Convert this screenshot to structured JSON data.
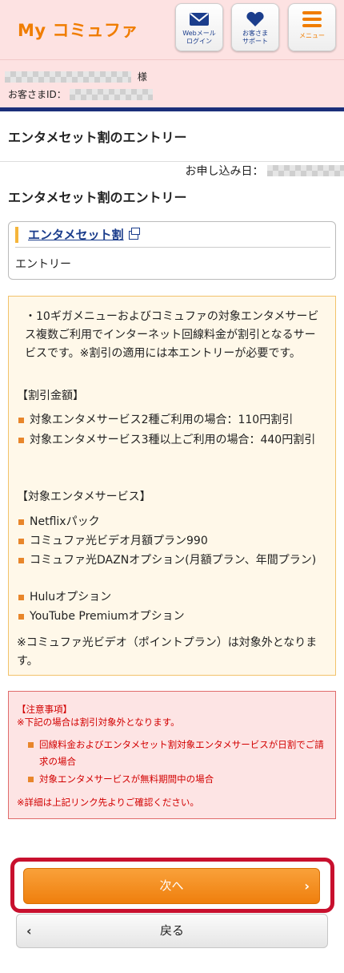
{
  "header": {
    "logo": "My コミュファ",
    "webmail_label": "Webメール\nログイン",
    "support_label": "お客さま\nサポート",
    "menu_label": "メニュー"
  },
  "customer": {
    "name_suffix": "様",
    "id_label": "お客さまID："
  },
  "page": {
    "title": "エンタメセット割のエントリー",
    "apply_date_label": "お申し込み日：",
    "section_title": "エンタメセット割のエントリー"
  },
  "service": {
    "link_label": "エンタメセット割",
    "subtitle": "エントリー"
  },
  "info": {
    "intro": "・10ギガメニューおよびコミュファの対象エンタメサービス複数ご利用でインターネット回線料金が割引となるサービスです。※割引の適用には本エントリーが必要です。",
    "discount_heading": "【割引金額】",
    "discounts": [
      "対象エンタメサービス2種ご利用の場合：110円割引",
      "対象エンタメサービス3種以上ご利用の場合：440円割引"
    ],
    "services_heading": "【対象エンタメサービス】",
    "services": [
      "Netflixパック",
      "コミュファ光ビデオ月額プラン990",
      "コミュファ光DAZNオプション(月額プラン、年間プラン)",
      "Huluオプション",
      "YouTube Premiumオプション"
    ],
    "note": "※コミュファ光ビデオ（ポイントプラン）は対象外となります。"
  },
  "warning": {
    "title": "【注意事項】",
    "subtitle": "※下記の場合は割引対象外となります。",
    "items": [
      "回線料金およびエンタメセット割対象エンタメサービスが日割でご請求の場合",
      "対象エンタメサービスが無料期間中の場合"
    ],
    "footer": "※詳細は上記リンク先よりご確認ください。"
  },
  "buttons": {
    "next": "次へ",
    "back": "戻る"
  }
}
